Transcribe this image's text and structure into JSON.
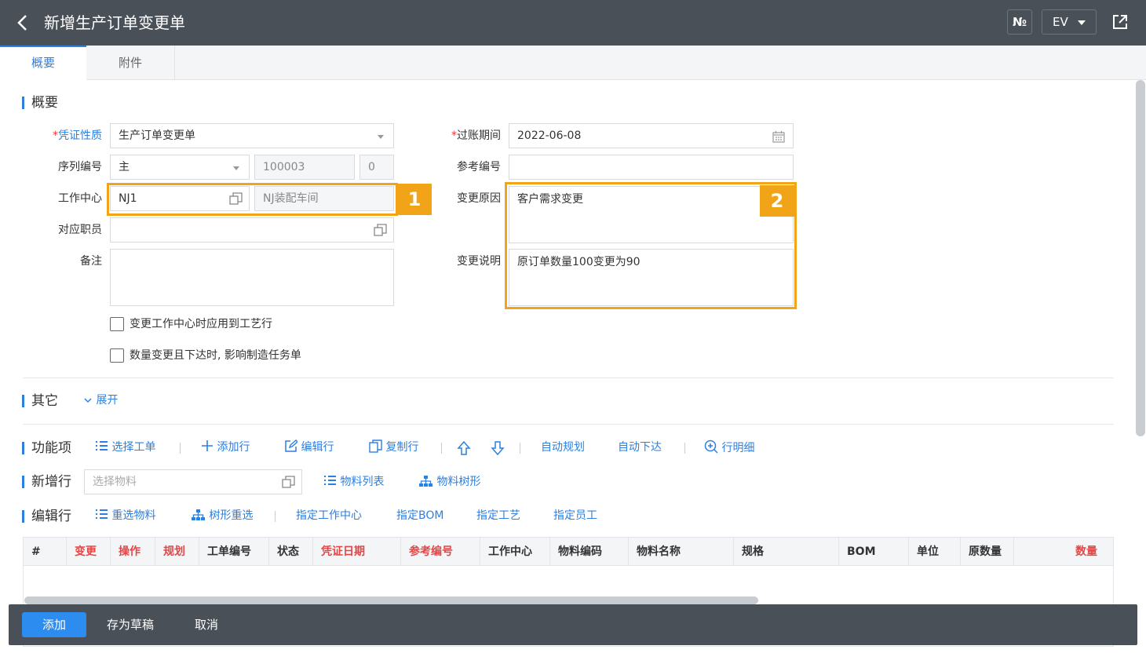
{
  "header": {
    "title": "新增生产订单变更单",
    "numbering_button": "№",
    "language_button": "EV"
  },
  "tabs": [
    {
      "label": "概要",
      "active": true
    },
    {
      "label": "附件",
      "active": false
    }
  ],
  "sections": {
    "summary": "概要",
    "other": "其它",
    "other_expand": "展开",
    "functions": "功能项",
    "add_row": "新增行",
    "edit_row": "编辑行"
  },
  "form": {
    "voucher_type": {
      "label": "凭证性质",
      "value": "生产订单变更单"
    },
    "sequence": {
      "label": "序列编号",
      "value": "主",
      "number": "100003",
      "suffix": "0"
    },
    "work_center": {
      "label": "工作中心",
      "code": "NJ1",
      "name": "NJ装配车间"
    },
    "employee": {
      "label": "对应职员",
      "value": ""
    },
    "remark": {
      "label": "备注",
      "value": ""
    },
    "posting_period": {
      "label": "过账期间",
      "value": "2022-06-08"
    },
    "reference_no": {
      "label": "参考编号",
      "value": ""
    },
    "change_reason": {
      "label": "变更原因",
      "value": "客户需求变更"
    },
    "change_desc": {
      "label": "变更说明",
      "value": "原订单数量100变更为90"
    },
    "checkbox1": {
      "label": "变更工作中心时应用到工艺行",
      "checked": false
    },
    "checkbox2": {
      "label": "数量变更且下达时, 影响制造任务单",
      "checked": false
    }
  },
  "callouts": [
    "1",
    "2"
  ],
  "function_bar": {
    "select_order": "选择工单",
    "add_line": "添加行",
    "edit_line": "编辑行",
    "copy_line": "复制行",
    "auto_plan": "自动规划",
    "auto_release": "自动下达",
    "line_detail": "行明细"
  },
  "add_row_bar": {
    "placeholder": "选择物料",
    "material_list": "物料列表",
    "material_tree": "物料树形"
  },
  "edit_row_bar": {
    "reselect": "重选物料",
    "tree_reselect": "树形重选",
    "assign_wc": "指定工作中心",
    "assign_bom": "指定BOM",
    "assign_route": "指定工艺",
    "assign_employee": "指定员工"
  },
  "table": {
    "columns": [
      "#",
      "变更",
      "操作",
      "规划",
      "工单编号",
      "状态",
      "凭证日期",
      "参考编号",
      "工作中心",
      "物料编码",
      "物料名称",
      "规格",
      "BOM",
      "单位",
      "原数量",
      "数量"
    ]
  },
  "footer": {
    "add": "添加",
    "save_draft": "存为草稿",
    "cancel": "取消"
  },
  "colors": {
    "accent": "#2d7fe0",
    "highlight": "#f2a419",
    "header_bg": "#4a5058",
    "required_col": "#e64545"
  }
}
